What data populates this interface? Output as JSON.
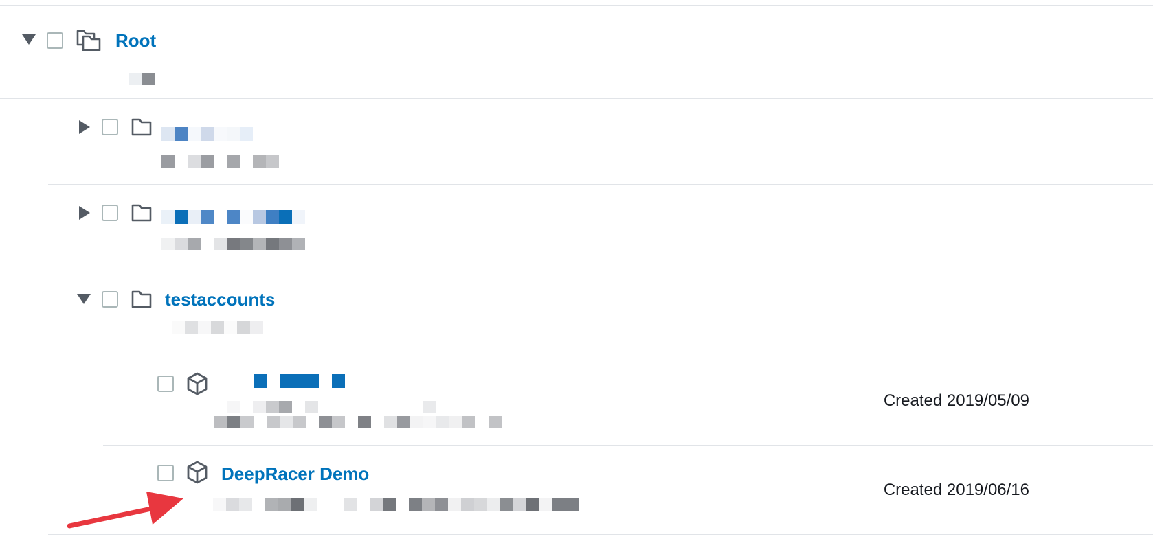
{
  "tree": {
    "root": {
      "label": "Root",
      "expanded": true
    },
    "testaccounts": {
      "label": "testaccounts",
      "expanded": true
    },
    "accounts": [
      {
        "label": "",
        "created": "Created 2019/05/09"
      },
      {
        "label": "DeepRacer Demo",
        "created": "Created 2019/06/16"
      }
    ]
  },
  "icons": {
    "expanded": "caret-down-icon",
    "collapsed": "caret-right-icon",
    "root": "root-folders-icon",
    "ou": "folder-icon",
    "account": "cube-icon",
    "annotation": "red-arrow-icon"
  },
  "colors": {
    "link": "#0073bb",
    "text": "#16191f",
    "annotation": "#e8373f"
  }
}
